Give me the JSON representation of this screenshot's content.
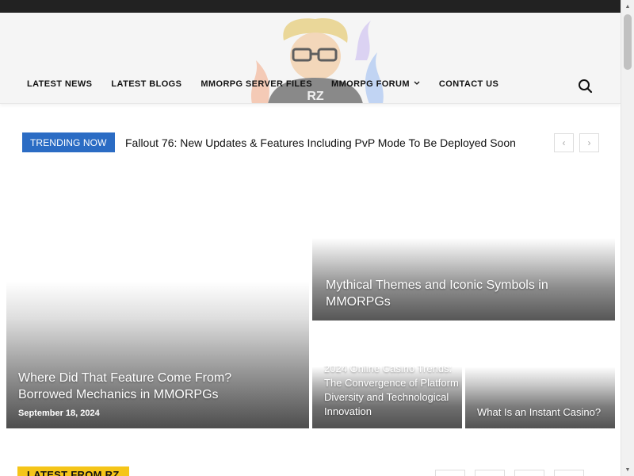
{
  "nav": {
    "items": [
      {
        "label": "LATEST NEWS"
      },
      {
        "label": "LATEST BLOGS"
      },
      {
        "label": "MMORPG SERVER FILES"
      },
      {
        "label": "MMORPG FORUM",
        "has_dropdown": true
      },
      {
        "label": "CONTACT US"
      }
    ],
    "search_icon": "search-icon"
  },
  "logo": {
    "text": "RZ"
  },
  "trending": {
    "label": "TRENDING NOW",
    "title": "Fallout 76: New Updates & Features Including PvP Mode To Be Deployed Soon",
    "prev_icon": "chevron-left-icon",
    "next_icon": "chevron-right-icon"
  },
  "featured": [
    {
      "title": "Where Did That Feature Come From? Borrowed Mechanics in MMORPGs",
      "date": "September 18, 2024"
    },
    {
      "title": "Mythical Themes and Iconic Symbols in MMORPGs"
    },
    {
      "title": "2024 Online Casino Trends: The Convergence of Platform Diversity and Technological Innovation"
    },
    {
      "title": "What Is an Instant Casino?"
    }
  ],
  "section": {
    "label": "LATEST FROM RZ"
  },
  "colors": {
    "accent": "#2b6cc4",
    "section": "#f5c518",
    "topbar": "#222222"
  }
}
